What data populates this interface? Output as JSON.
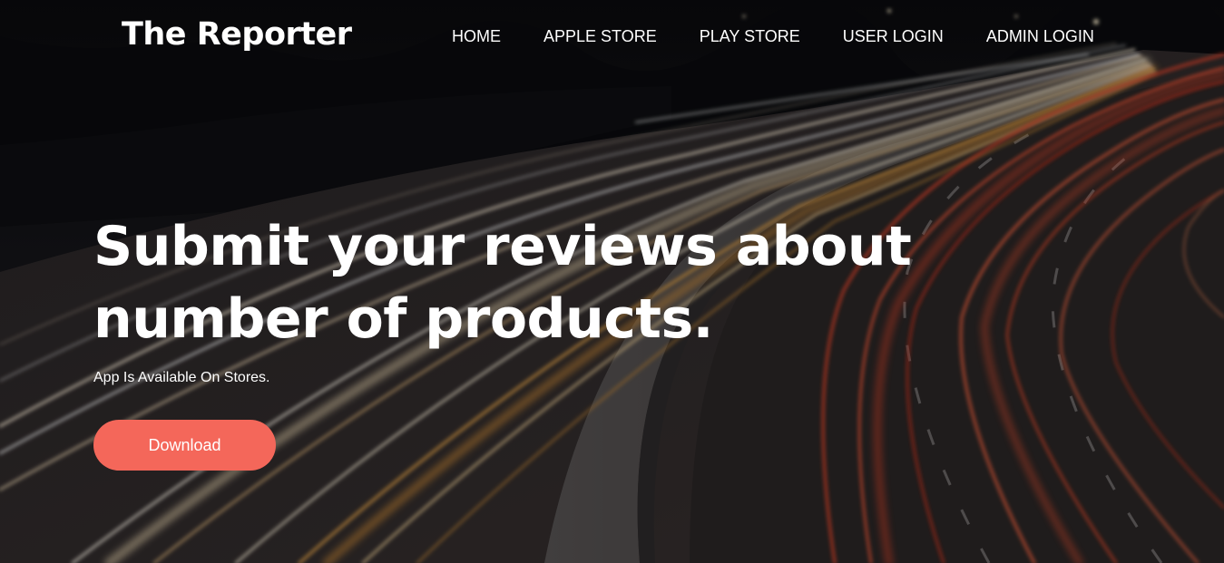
{
  "brand": {
    "name": "The Reporter"
  },
  "nav": {
    "items": [
      {
        "label": "HOME"
      },
      {
        "label": "APPLE STORE"
      },
      {
        "label": "PLAY STORE"
      },
      {
        "label": "USER LOGIN"
      },
      {
        "label": "ADMIN LOGIN"
      }
    ]
  },
  "hero": {
    "headline": "Submit your reviews about number of products.",
    "subtitle": "App Is Available On Stores.",
    "cta_label": "Download"
  },
  "colors": {
    "accent": "#f4675a",
    "text": "#ffffff",
    "background": "#0c0c0f"
  },
  "icons": {
    "background": "highway-light-trails-photo"
  }
}
